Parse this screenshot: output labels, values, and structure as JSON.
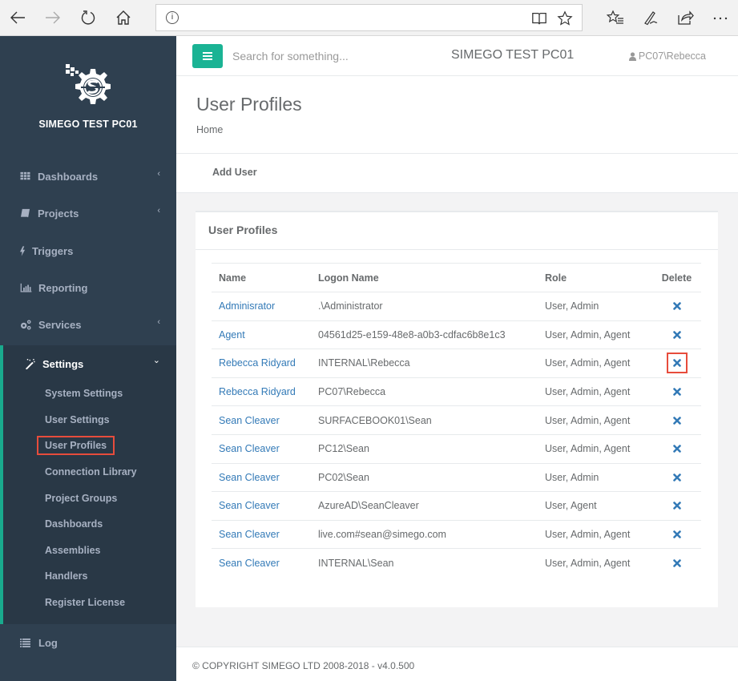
{
  "browser": {
    "address": "",
    "buttons": [
      "back",
      "forward",
      "refresh",
      "home",
      "reading-view",
      "favorite",
      "favorites-hub",
      "web-note",
      "share",
      "more"
    ]
  },
  "sidebar": {
    "brand": "SIMEGO TEST PC01",
    "items": [
      {
        "label": "Dashboards",
        "icon": "grid-icon",
        "chevron": "‹"
      },
      {
        "label": "Projects",
        "icon": "book-icon",
        "chevron": "‹"
      },
      {
        "label": "Triggers",
        "icon": "bolt-icon",
        "chevron": ""
      },
      {
        "label": "Reporting",
        "icon": "bar-chart-icon",
        "chevron": ""
      },
      {
        "label": "Services",
        "icon": "cogs-icon",
        "chevron": "‹"
      },
      {
        "label": "Settings",
        "icon": "magic-wand-icon",
        "chevron": "⌄"
      },
      {
        "label": "Log",
        "icon": "list-icon",
        "chevron": ""
      }
    ],
    "settings_sub": [
      "System Settings",
      "User Settings",
      "User Profiles",
      "Connection Library",
      "Project Groups",
      "Dashboards",
      "Assemblies",
      "Handlers",
      "Register License"
    ],
    "highlighted_sub": "User Profiles"
  },
  "topbar": {
    "search_placeholder": "Search for something...",
    "site_title": "SIMEGO TEST PC01",
    "user": "PC07\\Rebecca"
  },
  "page": {
    "title": "User Profiles",
    "breadcrumb": "Home",
    "add_user": "Add User"
  },
  "panel": {
    "title": "User Profiles",
    "columns": [
      "Name",
      "Logon Name",
      "Role",
      "Delete"
    ],
    "rows": [
      {
        "name": "Adminisrator",
        "logon": ".\\Administrator",
        "role": "User, Admin"
      },
      {
        "name": "Agent",
        "logon": "04561d25-e159-48e8-a0b3-cdfac6b8e1c3",
        "role": "User, Admin, Agent"
      },
      {
        "name": "Rebecca Ridyard",
        "logon": "INTERNAL\\Rebecca",
        "role": "User, Admin, Agent",
        "highlight_delete": true
      },
      {
        "name": "Rebecca Ridyard",
        "logon": "PC07\\Rebecca",
        "role": "User, Admin, Agent"
      },
      {
        "name": "Sean Cleaver",
        "logon": "SURFACEBOOK01\\Sean",
        "role": "User, Admin, Agent"
      },
      {
        "name": "Sean Cleaver",
        "logon": "PC12\\Sean",
        "role": "User, Admin, Agent"
      },
      {
        "name": "Sean Cleaver",
        "logon": "PC02\\Sean",
        "role": "User, Admin"
      },
      {
        "name": "Sean Cleaver",
        "logon": "AzureAD\\SeanCleaver",
        "role": "User, Agent"
      },
      {
        "name": "Sean Cleaver",
        "logon": "live.com#sean@simego.com",
        "role": "User, Admin, Agent"
      },
      {
        "name": "Sean Cleaver",
        "logon": "INTERNAL\\Sean",
        "role": "User, Admin, Agent"
      }
    ]
  },
  "footer": {
    "text": "© COPYRIGHT SIMEGO LTD 2008-2018 - v4.0.500"
  },
  "colors": {
    "sidebar_bg": "#2f4050",
    "sidebar_active_bg": "#293846",
    "accent": "#1ab394",
    "link": "#337ab7",
    "highlight": "#e74c3c"
  }
}
